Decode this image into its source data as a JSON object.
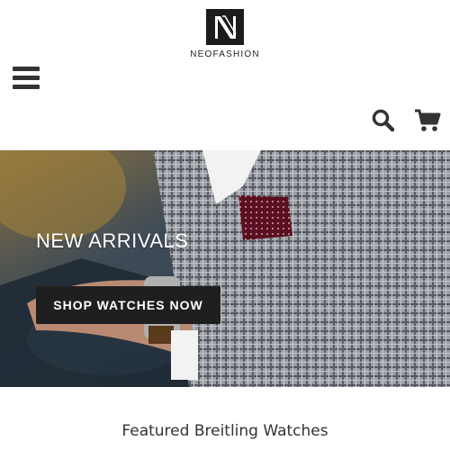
{
  "brand": {
    "name": "NEOFASHION",
    "logo_letter": "N",
    "logo_color": "#1c1c1c"
  },
  "header": {
    "menu_icon": "hamburger-menu-icon",
    "search_icon": "search-icon",
    "cart_icon": "shopping-cart-icon"
  },
  "hero": {
    "title": "NEW ARRIVALS",
    "button_label": "SHOP WATCHES NOW",
    "button_color": "#1f1f1f"
  },
  "featured": {
    "title": "Featured Breitling Watches"
  }
}
